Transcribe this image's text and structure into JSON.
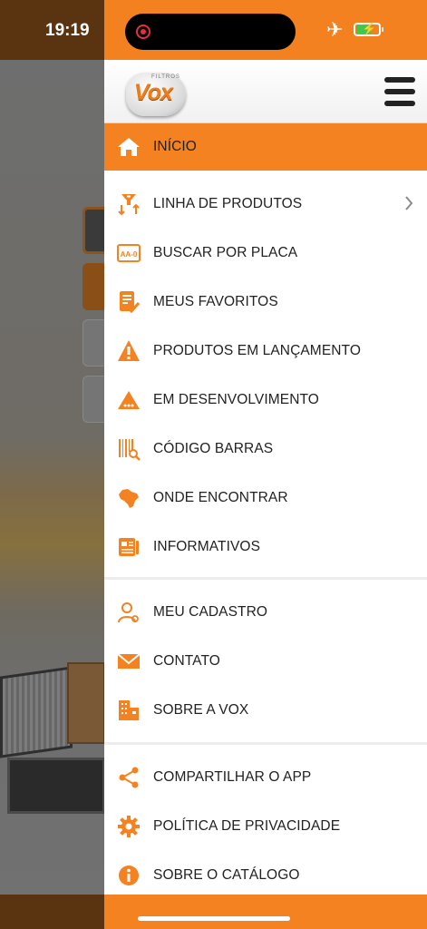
{
  "status_bar": {
    "time": "19:19"
  },
  "brand": {
    "logo_text": "Vox",
    "logo_small": "FILTROS",
    "accent": "#f58220"
  },
  "menu": {
    "active": {
      "label": "INÍCIO",
      "icon": "home-icon"
    },
    "items": [
      {
        "label": "LINHA DE PRODUTOS",
        "icon": "filter-icon",
        "has_submenu": true
      },
      {
        "label": "BUSCAR POR PLACA",
        "icon": "license-plate-icon",
        "plate_text": "AA-0"
      },
      {
        "label": "MEUS FAVORITOS",
        "icon": "favorites-list-icon"
      },
      {
        "label": "PRODUTOS EM LANÇAMENTO",
        "icon": "warning-icon"
      },
      {
        "label": "EM DESENVOLVIMENTO",
        "icon": "development-icon"
      },
      {
        "label": "CÓDIGO BARRAS",
        "icon": "barcode-icon"
      },
      {
        "label": "ONDE ENCONTRAR",
        "icon": "brazil-map-icon"
      },
      {
        "label": "INFORMATIVOS",
        "icon": "newspaper-icon"
      }
    ],
    "account_items": [
      {
        "label": "MEU CADASTRO",
        "icon": "user-icon"
      },
      {
        "label": "CONTATO",
        "icon": "envelope-icon"
      },
      {
        "label": "SOBRE A VOX",
        "icon": "building-icon"
      }
    ],
    "app_items": [
      {
        "label": "COMPARTILHAR O APP",
        "icon": "share-icon"
      },
      {
        "label": "POLÍTICA DE PRIVACIDADE",
        "icon": "gear-icon"
      },
      {
        "label": "SOBRE O CATÁLOGO",
        "icon": "info-icon"
      }
    ]
  }
}
